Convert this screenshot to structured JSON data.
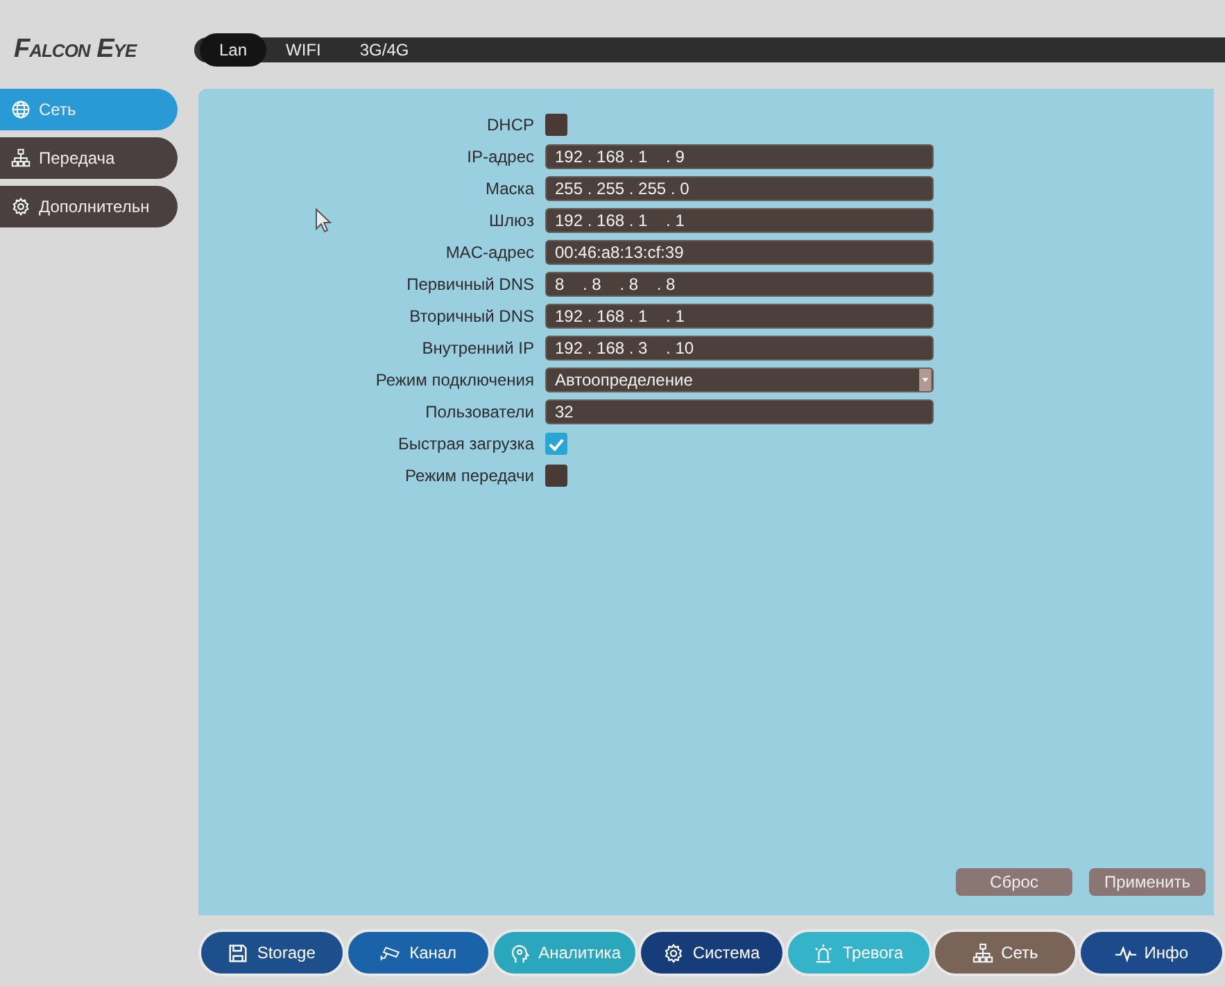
{
  "logo": "Falcon Eye",
  "tabs": [
    {
      "label": "Lan",
      "selected": true
    },
    {
      "label": "WIFI",
      "selected": false
    },
    {
      "label": "3G/4G",
      "selected": false
    }
  ],
  "sidebar": {
    "items": [
      {
        "label": "Сеть",
        "selected": true
      },
      {
        "label": "Передача",
        "selected": false
      },
      {
        "label": "Дополнительн",
        "selected": false
      }
    ]
  },
  "form": {
    "rows": [
      {
        "kind": "checkbox",
        "label": "DHCP",
        "checked": false
      },
      {
        "kind": "text",
        "label": "IP-адрес",
        "value": "192 . 168 . 1    . 9"
      },
      {
        "kind": "text",
        "label": "Маска",
        "value": "255 . 255 . 255 . 0"
      },
      {
        "kind": "text",
        "label": "Шлюз",
        "value": "192 . 168 . 1    . 1"
      },
      {
        "kind": "text",
        "label": "MAC-адрес",
        "value": "00:46:a8:13:cf:39"
      },
      {
        "kind": "text",
        "label": "Первичный DNS",
        "value": "8    . 8    . 8    . 8"
      },
      {
        "kind": "text",
        "label": "Вторичный DNS",
        "value": "192 . 168 . 1    . 1"
      },
      {
        "kind": "text",
        "label": "Внутренний IP",
        "value": "192 . 168 . 3    . 10"
      },
      {
        "kind": "select",
        "label": "Режим подключения",
        "value": "Автоопределение"
      },
      {
        "kind": "text",
        "label": "Пользователи",
        "value": "32"
      },
      {
        "kind": "checkbox",
        "label": "Быстрая загрузка",
        "checked": true
      },
      {
        "kind": "checkbox",
        "label": "Режим передачи",
        "checked": false
      }
    ]
  },
  "buttons": [
    "Сброс",
    "Применить"
  ],
  "bottom_nav": [
    {
      "label": "Storage",
      "color": "#1d4f8c"
    },
    {
      "label": "Канал",
      "color": "#1a63a8"
    },
    {
      "label": "Аналитика",
      "color": "#2aa6bd"
    },
    {
      "label": "Система",
      "color": "#163d7a"
    },
    {
      "label": "Тревога",
      "color": "#35b3c8"
    },
    {
      "label": "Сеть",
      "color": "#7a6458"
    },
    {
      "label": "Инфо",
      "color": "#1c4a8a"
    }
  ]
}
